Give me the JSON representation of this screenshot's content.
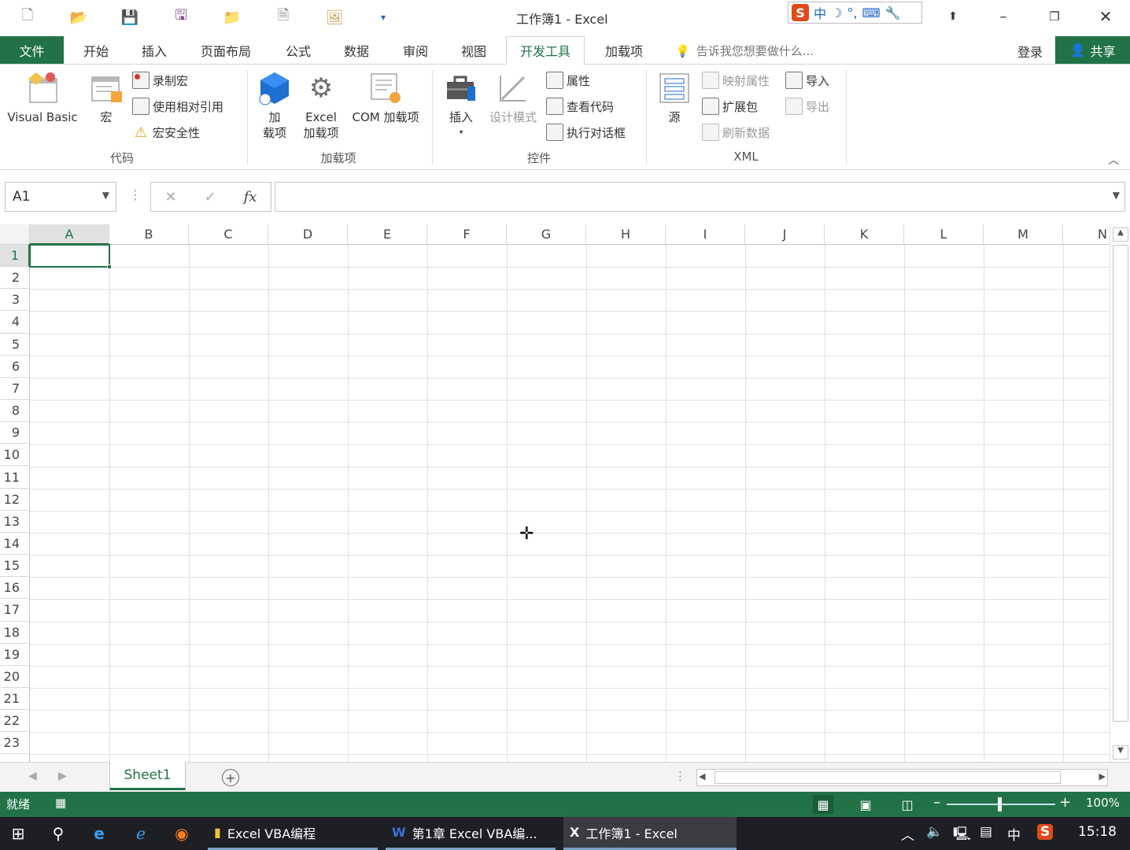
{
  "window": {
    "title": "工作簿1 - Excel"
  },
  "ime": {
    "logo": "S",
    "lang": "中",
    "moon": "☽",
    "punct": "°,"
  },
  "tabs": {
    "file": "文件",
    "items": [
      "开始",
      "插入",
      "页面布局",
      "公式",
      "数据",
      "审阅",
      "视图",
      "开发工具",
      "加载项"
    ],
    "active": "开发工具",
    "tellme": "告诉我您想要做什么...",
    "login": "登录",
    "share": "共享"
  },
  "ribbon": {
    "code": {
      "label": "代码",
      "vb": "Visual Basic",
      "macro": "宏",
      "record": "录制宏",
      "relative": "使用相对引用",
      "security": "宏安全性"
    },
    "addins": {
      "label": "加载项",
      "addin1": "加",
      "addin2": "载项",
      "excel1": "Excel",
      "excel2": "加载项",
      "com": "COM 加载项"
    },
    "controls": {
      "label": "控件",
      "insert": "插入",
      "design": "设计模式",
      "properties": "属性",
      "viewcode": "查看代码",
      "dialog": "执行对话框"
    },
    "xml": {
      "label": "XML",
      "source": "源",
      "mapprops": "映射属性",
      "expansion": "扩展包",
      "refresh": "刷新数据",
      "import": "导入",
      "export": "导出"
    }
  },
  "formula": {
    "namebox": "A1",
    "cancel": "✕",
    "enter": "✓",
    "fx": "fx",
    "value": ""
  },
  "grid": {
    "columns": [
      "A",
      "B",
      "C",
      "D",
      "E",
      "F",
      "G",
      "H",
      "I",
      "J",
      "K",
      "L",
      "M",
      "N"
    ],
    "rows": [
      "1",
      "2",
      "3",
      "4",
      "5",
      "6",
      "7",
      "8",
      "9",
      "10",
      "11",
      "12",
      "13",
      "14",
      "15",
      "16",
      "17",
      "18",
      "19",
      "20",
      "21",
      "22",
      "23"
    ],
    "selected_cell": "A1"
  },
  "sheets": {
    "tabs": [
      "Sheet1"
    ],
    "active": "Sheet1"
  },
  "status": {
    "ready": "就绪",
    "zoom": "100%"
  },
  "taskbar": {
    "apps": [
      {
        "label": "Excel VBA编程"
      },
      {
        "label": "第1章 Excel VBA编..."
      },
      {
        "label": "工作簿1 - Excel"
      }
    ],
    "tray_lang": "中",
    "time": "15:18"
  },
  "colors": {
    "accent": "#217346",
    "taskbar": "#1d1f24"
  }
}
